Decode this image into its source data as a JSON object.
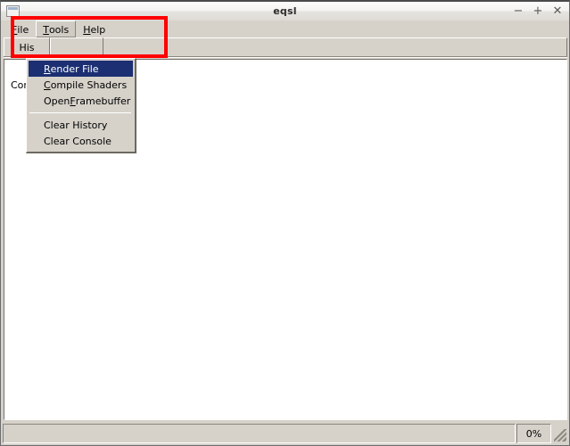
{
  "window": {
    "title": "eqsl",
    "icon": "window-icon",
    "controls": [
      {
        "name": "minimize-button",
        "glyph": "−"
      },
      {
        "name": "maximize-button",
        "glyph": "+"
      },
      {
        "name": "close-button",
        "glyph": "✕"
      }
    ]
  },
  "menubar": {
    "items": [
      {
        "label": "File",
        "mnemonic": "F",
        "rest": "ile",
        "open": false
      },
      {
        "label": "Tools",
        "mnemonic": "T",
        "rest": "ools",
        "open": true
      },
      {
        "label": "Help",
        "mnemonic": "H",
        "rest": "elp",
        "open": false
      }
    ]
  },
  "dropdown": {
    "owner": "Tools",
    "items": [
      {
        "type": "item",
        "pre": "",
        "mnemonic": "R",
        "post": "ender File",
        "label": "Render File",
        "highlighted": true
      },
      {
        "type": "item",
        "pre": "",
        "mnemonic": "C",
        "post": "ompile Shaders",
        "label": "Compile Shaders",
        "highlighted": false
      },
      {
        "type": "item",
        "pre": "Open ",
        "mnemonic": "F",
        "post": "ramebuffer",
        "label": "Open Framebuffer",
        "highlighted": false
      },
      {
        "type": "separator"
      },
      {
        "type": "item",
        "pre": "Clear History",
        "mnemonic": "",
        "post": "",
        "label": "Clear History",
        "highlighted": false
      },
      {
        "type": "item",
        "pre": "Clear Console",
        "mnemonic": "",
        "post": "",
        "label": "Clear Console",
        "highlighted": false
      }
    ]
  },
  "tabs": [
    {
      "label": "His",
      "full": "History",
      "selected": true
    },
    {
      "label": "",
      "full": "",
      "selected": false
    }
  ],
  "content": {
    "text": "Com"
  },
  "statusbar": {
    "message": "",
    "percent": "0%",
    "grip": "resize-grip-icon"
  },
  "colors": {
    "face": "#d6d2ca",
    "menu_highlight": "#1b2f72",
    "annotation": "#fe0000",
    "panel": "#ffffff"
  }
}
